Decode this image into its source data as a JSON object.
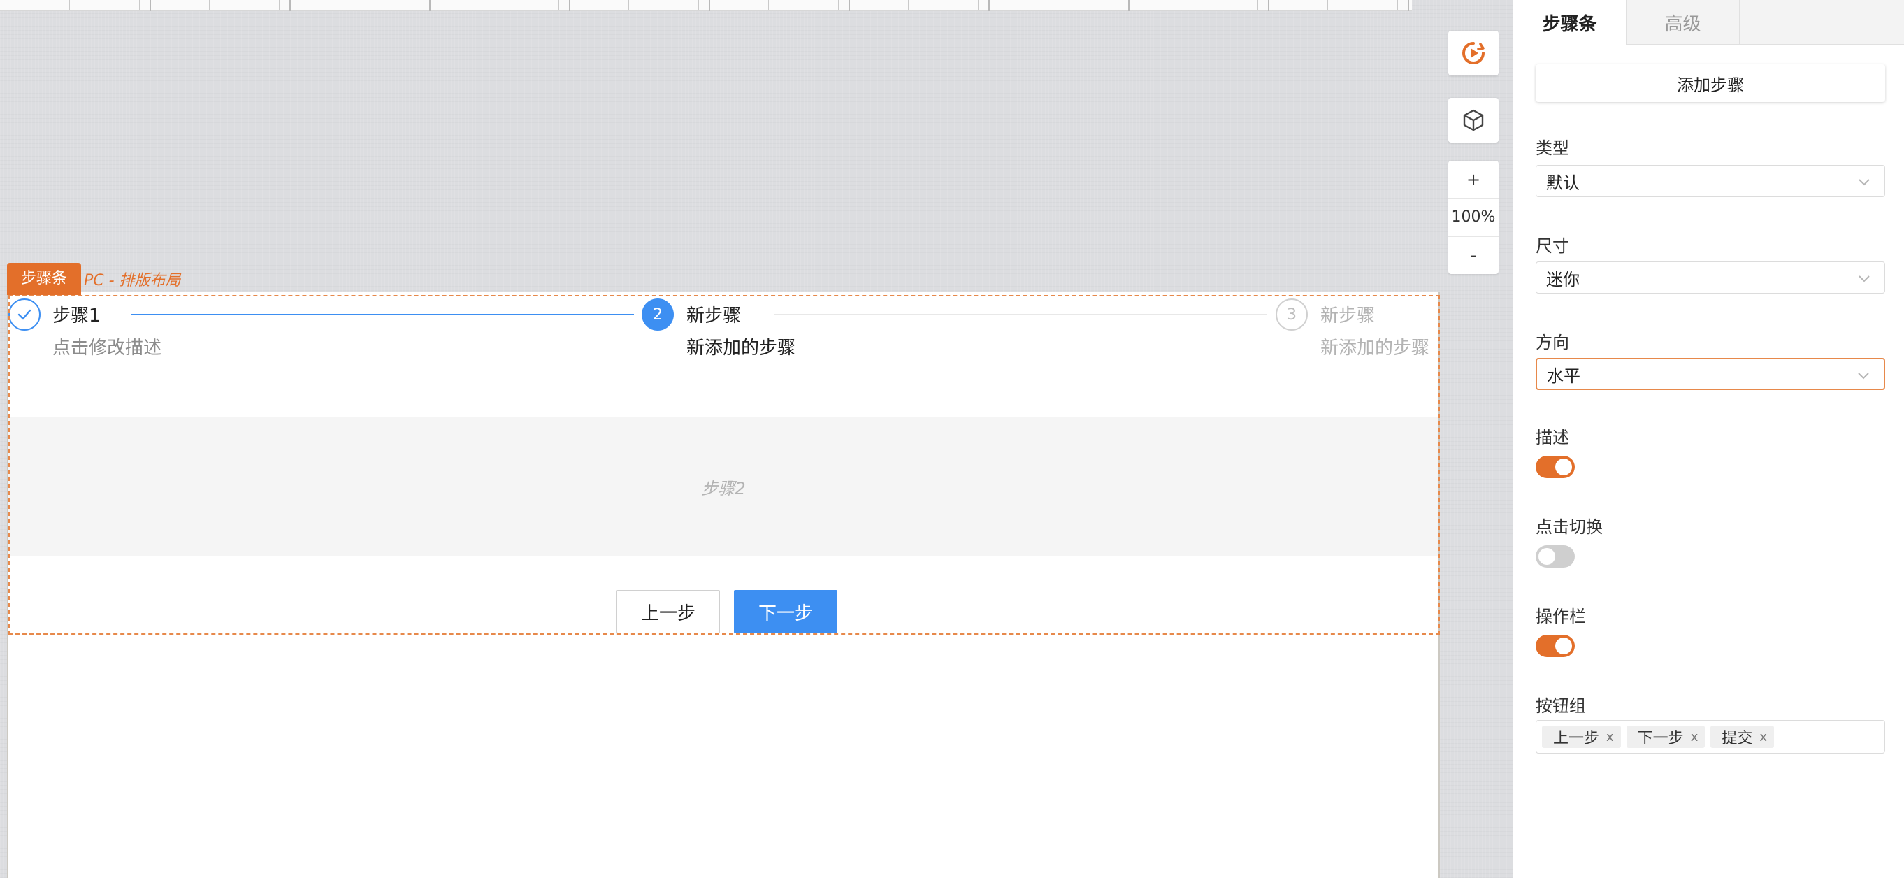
{
  "canvas": {
    "page_label": "步骤条",
    "page_sublabel": "PC - 排版布局",
    "zoom": {
      "plus": "+",
      "level": "100%",
      "minus": "-"
    },
    "tool_icons": [
      "play-circle-icon",
      "cube-icon"
    ],
    "steps": [
      {
        "number": "1",
        "title": "步骤1",
        "description": "点击修改描述",
        "state": "finished"
      },
      {
        "number": "2",
        "title": "新步骤",
        "description": "新添加的步骤",
        "state": "active"
      },
      {
        "number": "3",
        "title": "新步骤",
        "description": "新添加的步骤",
        "state": "waiting"
      }
    ],
    "content_placeholder": "步骤2",
    "buttons": {
      "prev": "上一步",
      "next": "下一步"
    }
  },
  "panel": {
    "tabs": [
      {
        "label": "步骤条",
        "active": true
      },
      {
        "label": "高级",
        "active": false
      }
    ],
    "add_step_label": "添加步骤",
    "fields": {
      "type": {
        "label": "类型",
        "value": "默认"
      },
      "size": {
        "label": "尺寸",
        "value": "迷你"
      },
      "direction": {
        "label": "方向",
        "value": "水平"
      },
      "description": {
        "label": "描述",
        "on": true
      },
      "click_switch": {
        "label": "点击切换",
        "on": false
      },
      "action_bar": {
        "label": "操作栏",
        "on": true
      },
      "button_group": {
        "label": "按钮组",
        "tags": [
          "上一步",
          "下一步",
          "提交"
        ]
      }
    }
  },
  "colors": {
    "accent": "#e36f2a",
    "primary_blue": "#3d8ff2",
    "canvas_bg": "#dcdde0"
  }
}
